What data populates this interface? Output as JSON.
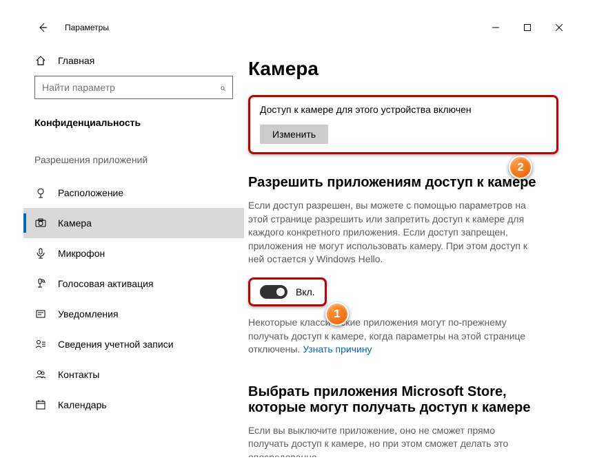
{
  "window": {
    "title": "Параметры",
    "min": "—",
    "max": "☐",
    "close": "✕"
  },
  "sidebar": {
    "home": "Главная",
    "search_placeholder": "Найти параметр",
    "category": "Конфиденциальность",
    "section_header": "Разрешения приложений",
    "items": [
      {
        "label": "Расположение",
        "icon": "location"
      },
      {
        "label": "Камера",
        "icon": "camera"
      },
      {
        "label": "Микрофон",
        "icon": "mic"
      },
      {
        "label": "Голосовая активация",
        "icon": "voice"
      },
      {
        "label": "Уведомления",
        "icon": "notif"
      },
      {
        "label": "Сведения учетной записи",
        "icon": "account"
      },
      {
        "label": "Контакты",
        "icon": "contacts"
      },
      {
        "label": "Календарь",
        "icon": "calendar"
      }
    ]
  },
  "main": {
    "title": "Камера",
    "device_access_text": "Доступ к камере для этого устройства включен",
    "change_btn": "Изменить",
    "allow_heading": "Разрешить приложениям доступ к камере",
    "allow_desc": "Если доступ разрешен, вы можете с помощью параметров на этой странице разрешить или запретить доступ к камере для каждого конкретного приложения. Если доступ запрещен, приложения не могут использовать камеру. При этом доступ к ней остается у Windows Hello.",
    "toggle_label": "Вкл.",
    "note_text": "Некоторые классические приложения могут по-прежнему получать доступ к камере, когда параметры на этой странице отключены. ",
    "note_link": "Узнать причину",
    "store_heading": "Выбрать приложения Microsoft Store, которые могут получать доступ к камере",
    "store_desc": "Если вы выключите приложение, оно не сможет прямо получать доступ к камере, но при этом сможет делать это опосредованно"
  },
  "annotations": {
    "b1": "1",
    "b2": "2"
  }
}
